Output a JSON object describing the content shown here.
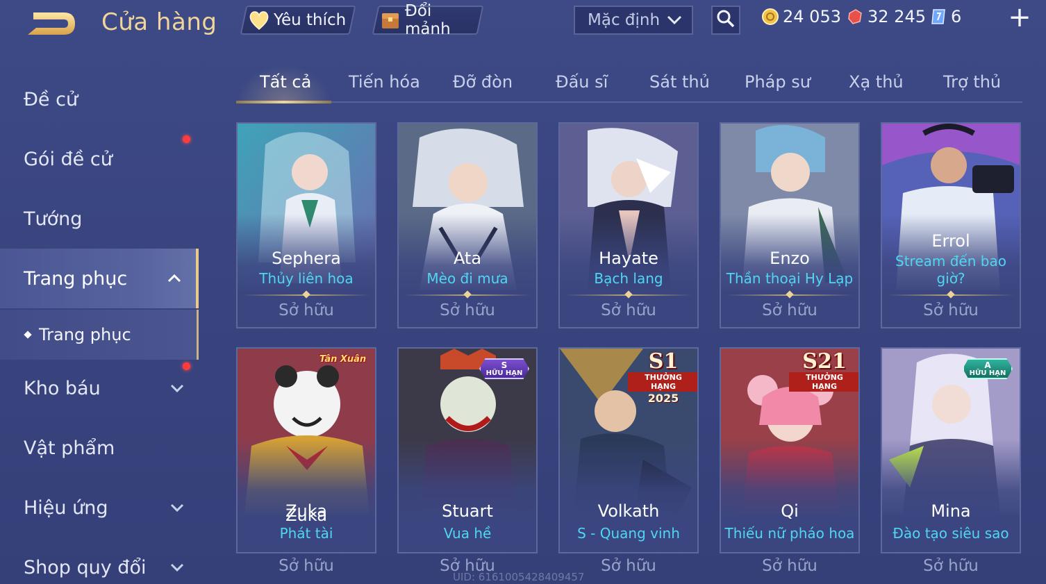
{
  "header": {
    "title": "Cửa hàng",
    "favorites_label": "Yêu thích",
    "exchange_label": "Đổi mảnh",
    "sort_value": "Mặc định",
    "currencies": [
      {
        "name": "gold",
        "value": "24 053",
        "color": "#f2c14a"
      },
      {
        "name": "voucher",
        "value": "32 245",
        "color": "#e8504a"
      },
      {
        "name": "crystal",
        "value": "6",
        "color": "#7fb6ff"
      }
    ]
  },
  "sidebar": {
    "items": [
      {
        "label": "Đề cử"
      },
      {
        "label": "Gói đề cử"
      },
      {
        "label": "Tướng"
      },
      {
        "label": "Trang phục"
      },
      {
        "label": "Trang phục"
      },
      {
        "label": "Kho báu"
      },
      {
        "label": "Vật phẩm"
      },
      {
        "label": "Hiệu ứng"
      },
      {
        "label": "Shop quy đổi"
      }
    ]
  },
  "tabs": [
    "Tất cả",
    "Tiến hóa",
    "Đỡ đòn",
    "Đấu sĩ",
    "Sát thủ",
    "Pháp sư",
    "Xạ thủ",
    "Trợ thủ"
  ],
  "cards": [
    {
      "hero": "Sephera",
      "skin": "Thủy liên hoa",
      "status": "Sở hữu",
      "badge": ""
    },
    {
      "hero": "Ata",
      "skin": "Mèo đi mưa",
      "status": "Sở hữu",
      "badge": ""
    },
    {
      "hero": "Hayate",
      "skin": "Bạch lang",
      "status": "Sở hữu",
      "badge": ""
    },
    {
      "hero": "Enzo",
      "skin": "Thần thoại Hy Lạp",
      "status": "Sở hữu",
      "badge": ""
    },
    {
      "hero": "Errol",
      "skin": "Stream đến bao giờ?",
      "status": "Sở hữu",
      "badge": ""
    },
    {
      "hero": "Zuka",
      "skin": "Phát tài",
      "status": "Sở hữu",
      "badge": "Tân Xuân"
    },
    {
      "hero": "Stuart",
      "skin": "Vua hề",
      "status": "Sở hữu",
      "badge_top": "S",
      "badge_bottom": "HỮU HẠN"
    },
    {
      "hero": "Volkath",
      "skin": "S - Quang vinh",
      "status": "Sở hữu",
      "badge_top": "S1",
      "badge_bottom": "THƯỞNG HẠNG",
      "badge_year": "2025"
    },
    {
      "hero": "Qi",
      "skin": "Thiếu nữ pháo hoa",
      "status": "Sở hữu",
      "badge_top": "S21",
      "badge_bottom": "THƯỞNG HẠNG"
    },
    {
      "hero": "Mina",
      "skin": "Đào tạo siêu sao",
      "status": "Sở hữu",
      "badge_top": "A",
      "badge_bottom": "HỮU HẠN"
    }
  ],
  "uid": "UID: 6161005428409457"
}
